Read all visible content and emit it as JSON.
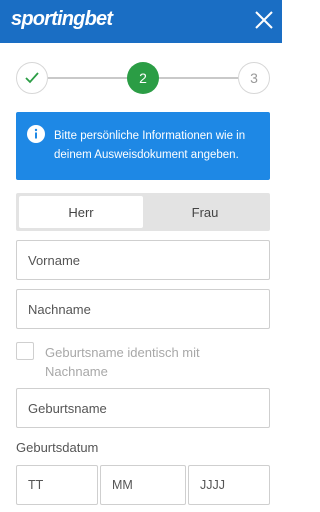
{
  "header": {
    "logo_text": "sportingbet",
    "close_icon": "close-icon",
    "background_color": "#1a6ec4"
  },
  "stepper": {
    "steps": [
      {
        "label": "",
        "state": "completed",
        "icon": "check-icon"
      },
      {
        "label": "2",
        "state": "active"
      },
      {
        "label": "3",
        "state": "pending"
      }
    ],
    "active_color": "#2b9d45"
  },
  "info": {
    "icon": "info-icon",
    "text": "Bitte persönliche Informationen wie in deinem Ausweisdokument angeben.",
    "background_color": "#1e88e5"
  },
  "gender": {
    "options": [
      "Herr",
      "Frau"
    ],
    "selected": "Herr"
  },
  "fields": {
    "first_name_placeholder": "Vorname",
    "last_name_placeholder": "Nachname",
    "birth_name_placeholder": "Geburtsname"
  },
  "checkbox": {
    "label": "Geburtsname identisch mit Nachname",
    "checked": false
  },
  "dob": {
    "label": "Geburtsdatum",
    "day_placeholder": "TT",
    "month_placeholder": "MM",
    "year_placeholder": "JJJJ"
  }
}
